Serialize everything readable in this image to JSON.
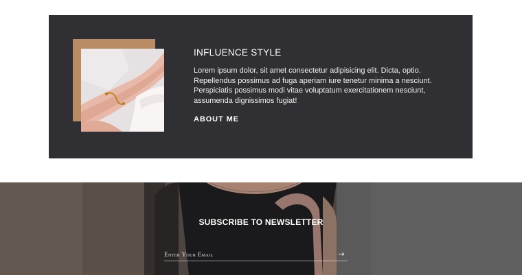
{
  "about": {
    "title": "INFLUENCE STYLE",
    "body": "Lorem ipsum dolor, sit amet consectetur adipisicing elit. Dicta, optio. Repellendus possimus ad fuga aperiam iure tenetur minima a nesciunt. Perspiciatis possimus modi vitae voluptatum exercitationem nesciunt, assumenda dignissimos fugiat!",
    "link_label": "ABOUT ME",
    "colors": {
      "panel": "#302f34",
      "accent_frame": "#b98c64"
    }
  },
  "newsletter": {
    "title": "SUBSCRIBE TO NEWSLETTER",
    "email_placeholder": "Enter Your Email",
    "email_value": "",
    "submit_icon": "arrow-right-icon",
    "submit_glyph": "→"
  }
}
